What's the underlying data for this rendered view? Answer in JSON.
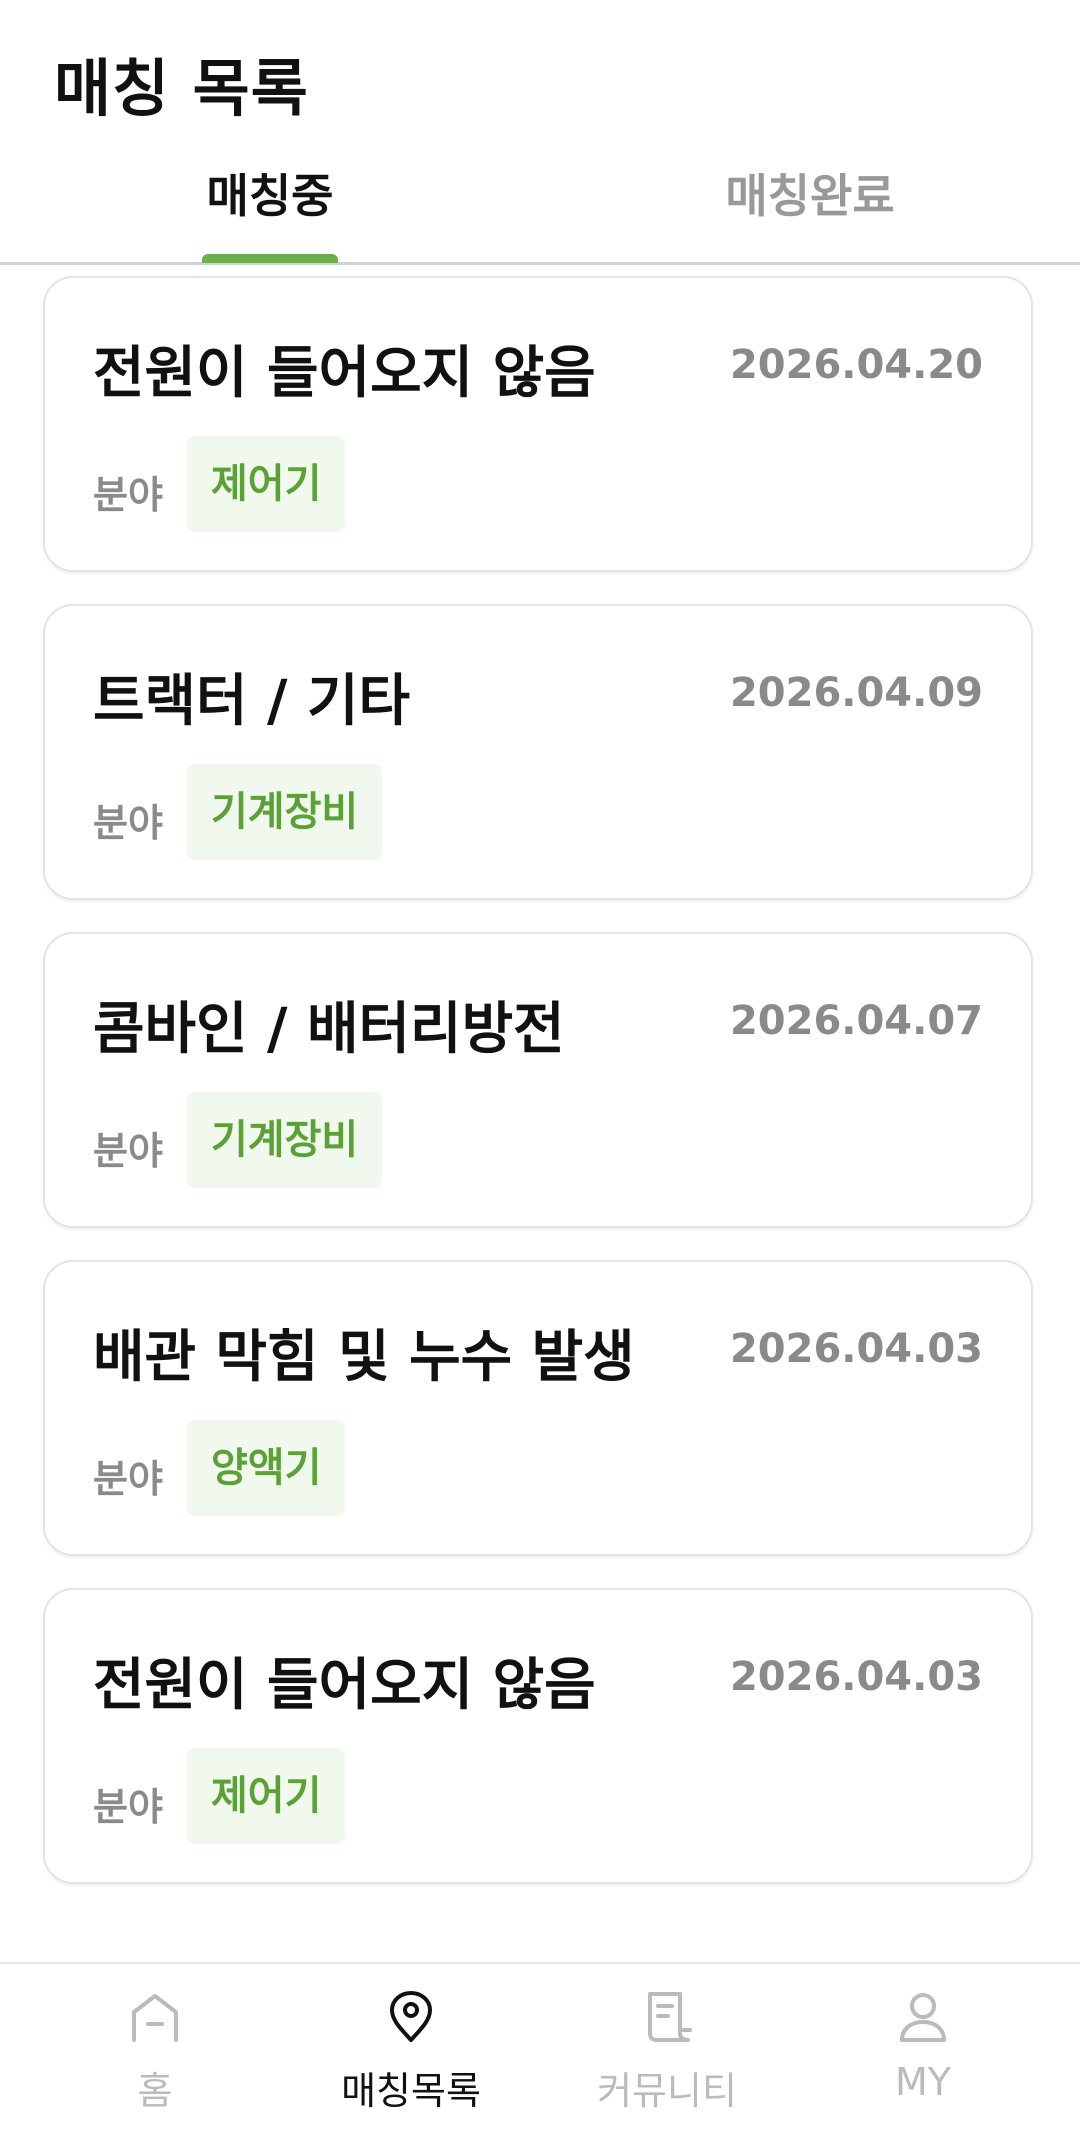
{
  "header": {
    "title": "매칭 목록"
  },
  "tabs": [
    {
      "label": "매칭중",
      "active": true
    },
    {
      "label": "매칭완료",
      "active": false
    }
  ],
  "field_label": "분야",
  "cards": [
    {
      "title": "전원이 들어오지 않음",
      "date": "2026.04.20",
      "field": "제어기"
    },
    {
      "title": "트랙터 / 기타",
      "date": "2026.04.09",
      "field": "기계장비"
    },
    {
      "title": "콤바인 / 배터리방전",
      "date": "2026.04.07",
      "field": "기계장비"
    },
    {
      "title": "배관 막힘 및 누수 발생",
      "date": "2026.04.03",
      "field": "양액기"
    },
    {
      "title": "전원이 들어오지 않음",
      "date": "2026.04.03",
      "field": "제어기"
    }
  ],
  "nav": [
    {
      "label": "홈",
      "icon": "home-icon",
      "active": false
    },
    {
      "label": "매칭목록",
      "icon": "location-pin-icon",
      "active": true
    },
    {
      "label": "커뮤니티",
      "icon": "document-icon",
      "active": false
    },
    {
      "label": "MY",
      "icon": "user-icon",
      "active": false
    }
  ],
  "colors": {
    "accent": "#6ab04c",
    "badge_bg": "#f1f8ee",
    "badge_text": "#5aa136",
    "muted": "#8a8a8a"
  }
}
